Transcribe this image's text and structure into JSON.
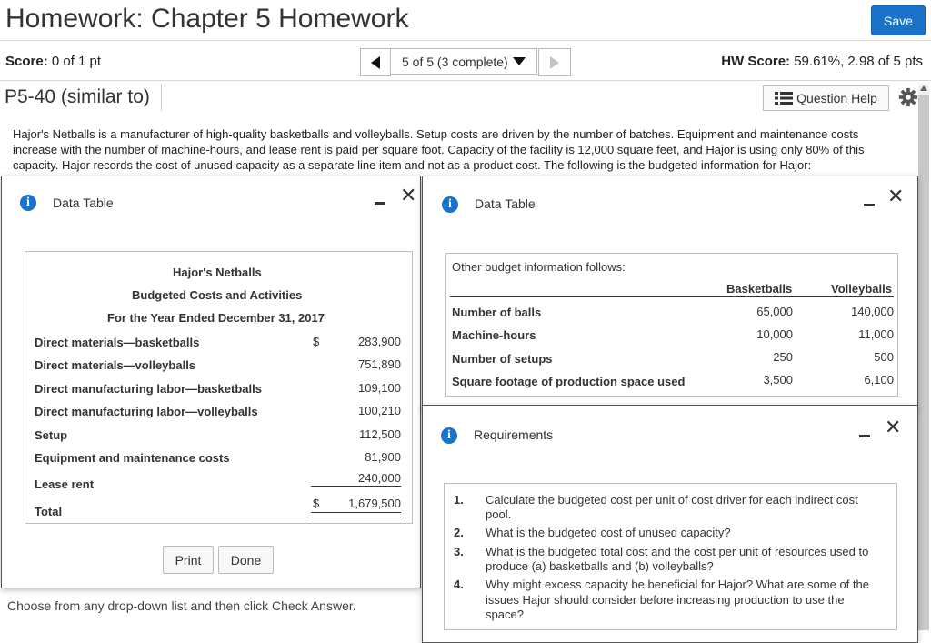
{
  "header": {
    "title": "Homework: Chapter 5 Homework",
    "save_label": "Save"
  },
  "scorebar": {
    "score_label": "Score:",
    "score_value": "0 of 1 pt",
    "nav_select_value": "5 of 5 (3 complete)",
    "hw_score_label": "HW Score:",
    "hw_score_value": "59.61%, 2.98 of 5 pts"
  },
  "problem": {
    "id": "P5-40 (similar to)",
    "question_help_label": "Question Help",
    "prompt": "Hajor's Netballs is a manufacturer of high-quality basketballs and volleyballs. Setup costs are driven by the number of batches. Equipment and maintenance costs increase with the number of machine-hours, and lease rent is paid per square foot. Capacity of the facility is 12,000 square feet, and Hajor is using only 80% of this capacity. Hajor records the cost of unused capacity as a separate line item and not as a product cost. The following is the budgeted information for Hajor:"
  },
  "dialog1": {
    "title": "Data Table",
    "heading1": "Hajor's Netballs",
    "heading2": "Budgeted Costs and Activities",
    "heading3": "For the Year Ended December 31, 2017",
    "rows": [
      {
        "label": "Direct materials—basketballs",
        "currency": "$",
        "value": "283,900"
      },
      {
        "label": "Direct materials—volleyballs",
        "currency": "",
        "value": "751,890"
      },
      {
        "label": "Direct manufacturing labor—basketballs",
        "currency": "",
        "value": "109,100"
      },
      {
        "label": "Direct manufacturing labor—volleyballs",
        "currency": "",
        "value": "100,210"
      },
      {
        "label": "Setup",
        "currency": "",
        "value": "112,500"
      },
      {
        "label": "Equipment and maintenance costs",
        "currency": "",
        "value": "81,900"
      },
      {
        "label": "Lease rent",
        "currency": "",
        "value": "240,000"
      }
    ],
    "total_label": "Total",
    "total_currency": "$",
    "total_value": "1,679,500",
    "print_label": "Print",
    "done_label": "Done"
  },
  "dialog2": {
    "title": "Data Table",
    "intro": "Other budget information follows:",
    "col1": "Basketballs",
    "col2": "Volleyballs",
    "rows": [
      {
        "label": "Number of balls",
        "v1": "65,000",
        "v2": "140,000"
      },
      {
        "label": "Machine-hours",
        "v1": "10,000",
        "v2": "11,000"
      },
      {
        "label": "Number of setups",
        "v1": "250",
        "v2": "500"
      },
      {
        "label": "Square footage of production space used",
        "v1": "3,500",
        "v2": "6,100"
      }
    ]
  },
  "dialog3": {
    "title": "Requirements",
    "items": [
      {
        "num": "1.",
        "line1": "Calculate the budgeted cost per unit of cost driver for each indirect cost",
        "line2": "pool.",
        "line3": ""
      },
      {
        "num": "2.",
        "line1": "What is the budgeted cost of unused capacity?",
        "line2": "",
        "line3": ""
      },
      {
        "num": "3.",
        "line1": "What is the budgeted total cost and the cost per unit of resources used to",
        "line2": "produce (a) basketballs and (b) volleyballs?",
        "line3": ""
      },
      {
        "num": "4.",
        "line1": "Why might excess capacity be beneficial for Hajor? What are some of the",
        "line2": "issues Hajor should consider before increasing production to use the",
        "line3": "space?"
      }
    ]
  },
  "footer": {
    "choose_text": "Choose from any drop-down list and then click Check Answer."
  },
  "icons": {
    "info": "i"
  },
  "colors": {
    "accent": "#1a73c8"
  }
}
